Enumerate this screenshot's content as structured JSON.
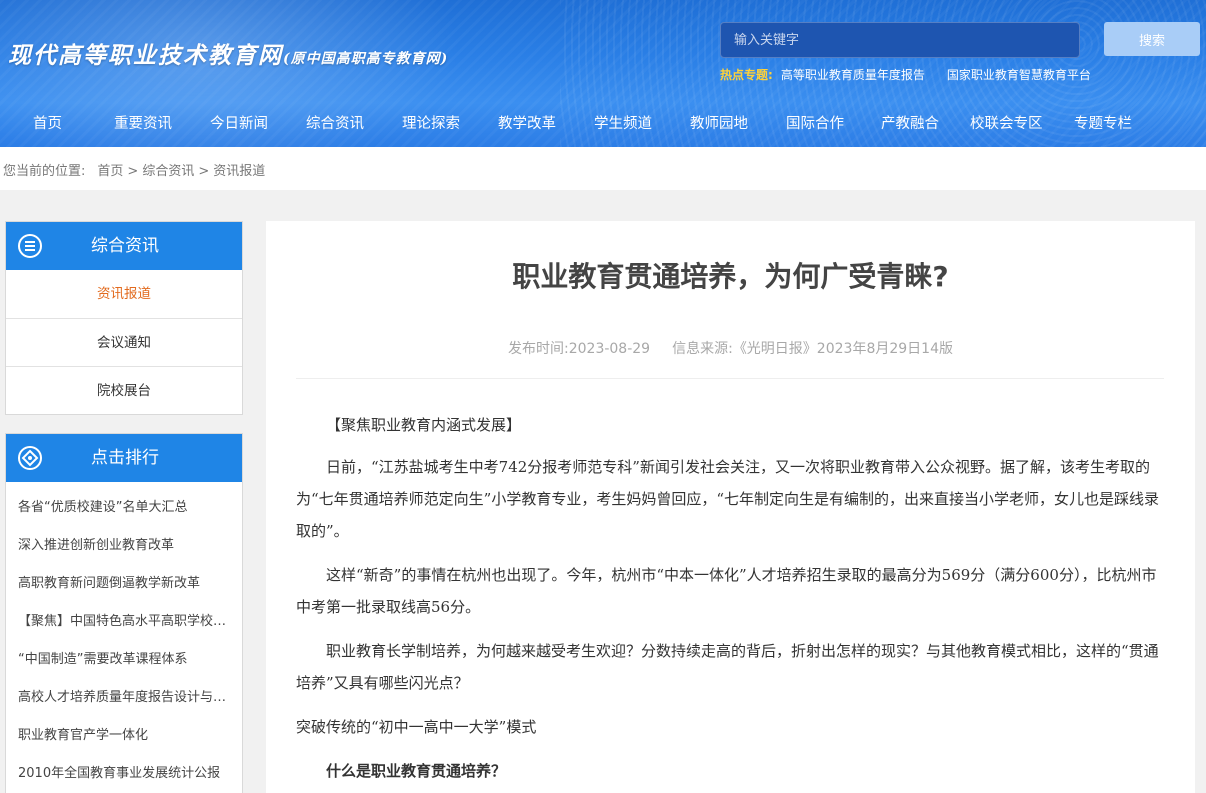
{
  "header": {
    "site_title": "现代高等职业技术教育网",
    "site_subtitle": "(原中国高职高专教育网)",
    "search_placeholder": "输入关键字",
    "search_button": "搜索",
    "hot_label": "热点专题:",
    "hot_links": [
      "高等职业教育质量年度报告",
      "国家职业教育智慧教育平台"
    ]
  },
  "nav": {
    "items": [
      "首页",
      "重要资讯",
      "今日新闻",
      "综合资讯",
      "理论探索",
      "教学改革",
      "学生频道",
      "教师园地",
      "国际合作",
      "产教融合",
      "校联会专区",
      "专题专栏"
    ]
  },
  "breadcrumb": {
    "lead": "您当前的位置:",
    "items": [
      "首页",
      "综合资讯",
      "资讯报道"
    ],
    "sep": ">"
  },
  "sidebar": {
    "category": {
      "title": "综合资讯",
      "items": [
        "资讯报道",
        "会议通知",
        "院校展台"
      ]
    },
    "ranking": {
      "title": "点击排行",
      "items": [
        "各省“优质校建设”名单大汇总",
        "深入推进创新创业教育改革",
        "高职教育新问题倒逼教学新改革",
        "【聚焦】中国特色高水平高职学校和专业建设计划",
        "“中国制造”需要改革课程体系",
        "高校人才培养质量年度报告设计与编制",
        "职业教育官产学一体化",
        "2010年全国教育事业发展统计公报"
      ]
    }
  },
  "article": {
    "title": "职业教育贯通培养，为何广受青睐?",
    "date_label": "发布时间:",
    "date": "2023-08-29",
    "source_label": "信息来源:",
    "source": "《光明日报》2023年8月29日14版",
    "paragraphs": [
      "【聚焦职业教育内涵式发展】",
      "日前，“江苏盐城考生中考742分报考师范专科”新闻引发社会关注，又一次将职业教育带入公众视野。据了解，该考生考取的为“七年贯通培养师范定向生”小学教育专业，考生妈妈曾回应，“七年制定向生是有编制的，出来直接当小学老师，女儿也是踩线录取的”。",
      "这样“新奇”的事情在杭州也出现了。今年，杭州市“中本一体化”人才培养招生录取的最高分为569分（满分600分），比杭州市中考第一批录取线高56分。",
      "职业教育长学制培养，为何越来越受考生欢迎？分数持续走高的背后，折射出怎样的现实？与其他教育模式相比，这样的“贯通培养”又具有哪些闪光点？",
      "突破传统的“初中一高中一大学”模式",
      "什么是职业教育贯通培养？"
    ]
  },
  "colors": {
    "header_blue": "#2a7fe6",
    "sidebar_head": "#1f85e6",
    "active_orange": "#e26b1f",
    "hot_yellow": "#ffd23a"
  }
}
